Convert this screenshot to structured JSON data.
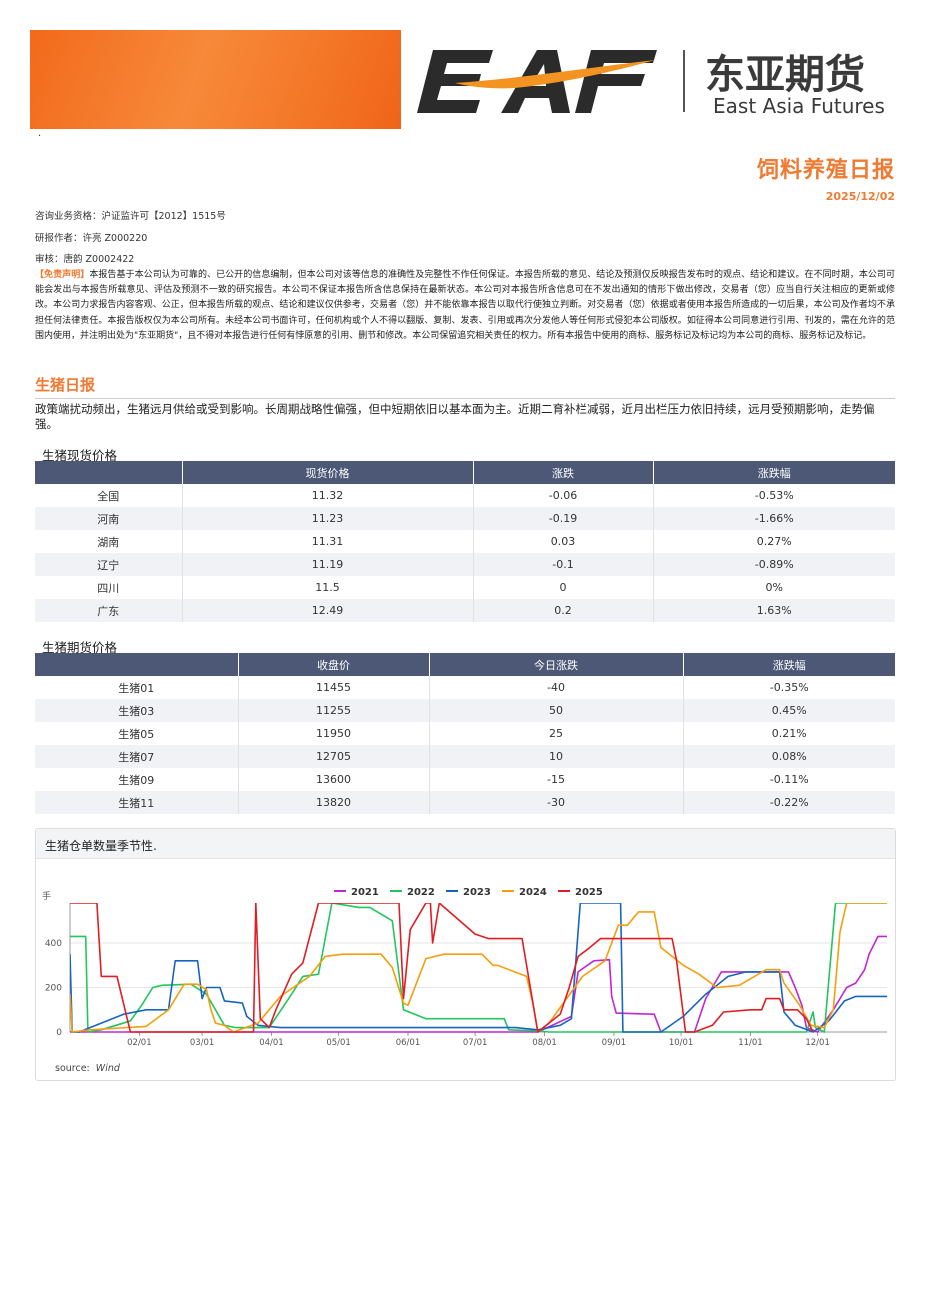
{
  "header": {
    "brand_letters": "EAF",
    "brand_cn": "东亚期货",
    "brand_en": "East Asia Futures",
    "dot": "·",
    "report_title": "饲料养殖日报",
    "report_date": "2025/12/02"
  },
  "meta": {
    "license": "咨询业务资格：沪证监许可【2012】1515号",
    "author": "研报作者：许亮 Z000220",
    "reviewer": "审核：唐韵 Z0002422"
  },
  "disclaimer": {
    "tag": "【免责声明】",
    "text": "本报告基于本公司认为可靠的、已公开的信息编制，但本公司对该等信息的准确性及完整性不作任何保证。本报告所载的意见、结论及预测仅反映报告发布时的观点、结论和建议。在不同时期，本公司可能会发出与本报告所载意见、评估及预测不一致的研究报告。本公司不保证本报告所含信息保持在最新状态。本公司对本报告所含信息可在不发出通知的情形下做出修改，交易者（您）应当自行关注相应的更新或修改。本公司力求报告内容客观、公正，但本报告所载的观点、结论和建议仅供参考，交易者（您）并不能依靠本报告以取代行使独立判断。对交易者（您）依据或者使用本报告所造成的一切后果，本公司及作者均不承担任何法律责任。本报告版权仅为本公司所有。未经本公司书面许可，任何机构或个人不得以翻版、复制、发表、引用或再次分发他人等任何形式侵犯本公司版权。如征得本公司同意进行引用、刊发的，需在允许的范围内使用，并注明出处为\"东亚期货\"，且不得对本报告进行任何有悖原意的引用、删节和修改。本公司保留追究相关责任的权力。所有本报告中使用的商标、服务标记及标记均为本公司的商标、服务标记及标记。"
  },
  "section": {
    "title": "生猪日报",
    "summary": "政策端扰动频出，生猪远月供给或受到影响。长周期战略性偏强，但中短期依旧以基本面为主。近期二育补栏减弱，近月出栏压力依旧持续，远月受预期影响，走势偏强。"
  },
  "spot_table": {
    "title": "生猪现货价格",
    "headers": [
      "",
      "现货价格",
      "涨跌",
      "涨跌幅"
    ],
    "rows": [
      [
        "全国",
        "11.32",
        "-0.06",
        "-0.53%"
      ],
      [
        "河南",
        "11.23",
        "-0.19",
        "-1.66%"
      ],
      [
        "湖南",
        "11.31",
        "0.03",
        "0.27%"
      ],
      [
        "辽宁",
        "11.19",
        "-0.1",
        "-0.89%"
      ],
      [
        "四川",
        "11.5",
        "0",
        "0%"
      ],
      [
        "广东",
        "12.49",
        "0.2",
        "1.63%"
      ]
    ]
  },
  "futures_table": {
    "title": "生猪期货价格",
    "headers": [
      "",
      "收盘价",
      "今日涨跌",
      "涨跌幅"
    ],
    "rows": [
      [
        "生猪01",
        "11455",
        "-40",
        "-0.35%"
      ],
      [
        "生猪03",
        "11255",
        "50",
        "0.45%"
      ],
      [
        "生猪05",
        "11950",
        "25",
        "0.21%"
      ],
      [
        "生猪07",
        "12705",
        "10",
        "0.08%"
      ],
      [
        "生猪09",
        "13600",
        "-15",
        "-0.11%"
      ],
      [
        "生猪11",
        "13820",
        "-30",
        "-0.22%"
      ]
    ]
  },
  "chart_block": {
    "title": "生猪仓单数量季节性.",
    "source_label": "source:",
    "source_value": "Wind"
  },
  "chart_data": {
    "type": "line",
    "ylabel": "手",
    "ylim": [
      0,
      580
    ],
    "yticks": [
      0,
      200,
      400
    ],
    "xlim": [
      1,
      366
    ],
    "xticks": [
      {
        "day": 32,
        "label": "02/01"
      },
      {
        "day": 60,
        "label": "03/01"
      },
      {
        "day": 91,
        "label": "04/01"
      },
      {
        "day": 121,
        "label": "05/01"
      },
      {
        "day": 152,
        "label": "06/01"
      },
      {
        "day": 182,
        "label": "07/01"
      },
      {
        "day": 213,
        "label": "08/01"
      },
      {
        "day": 244,
        "label": "09/01"
      },
      {
        "day": 274,
        "label": "10/01"
      },
      {
        "day": 305,
        "label": "11/01"
      },
      {
        "day": 335,
        "label": "12/01"
      }
    ],
    "legend_position": "top",
    "series": [
      {
        "name": "2021",
        "color": "#c026d3",
        "points": [
          [
            1,
            0
          ],
          [
            160,
            0
          ],
          [
            165,
            0
          ],
          [
            205,
            0
          ],
          [
            210,
            0
          ],
          [
            225,
            70
          ],
          [
            228,
            270
          ],
          [
            235,
            320
          ],
          [
            242,
            325
          ],
          [
            243,
            160
          ],
          [
            245,
            85
          ],
          [
            262,
            80
          ],
          [
            265,
            0
          ],
          [
            280,
            0
          ],
          [
            285,
            150
          ],
          [
            292,
            270
          ],
          [
            310,
            270
          ],
          [
            322,
            270
          ],
          [
            325,
            200
          ],
          [
            328,
            120
          ],
          [
            330,
            20
          ],
          [
            335,
            0
          ],
          [
            342,
            100
          ],
          [
            348,
            200
          ],
          [
            352,
            220
          ],
          [
            356,
            280
          ],
          [
            358,
            350
          ],
          [
            362,
            430
          ],
          [
            366,
            430
          ]
        ]
      },
      {
        "name": "2022",
        "color": "#22c55e",
        "points": [
          [
            1,
            430
          ],
          [
            8,
            430
          ],
          [
            9,
            0
          ],
          [
            15,
            10
          ],
          [
            28,
            50
          ],
          [
            33,
            120
          ],
          [
            38,
            200
          ],
          [
            42,
            210
          ],
          [
            55,
            215
          ],
          [
            62,
            170
          ],
          [
            70,
            30
          ],
          [
            75,
            20
          ],
          [
            90,
            20
          ],
          [
            100,
            170
          ],
          [
            105,
            250
          ],
          [
            112,
            260
          ],
          [
            118,
            580
          ],
          [
            130,
            560
          ],
          [
            135,
            560
          ],
          [
            145,
            500
          ],
          [
            150,
            100
          ],
          [
            160,
            60
          ],
          [
            175,
            60
          ],
          [
            195,
            60
          ],
          [
            197,
            10
          ],
          [
            210,
            5
          ],
          [
            215,
            0
          ],
          [
            230,
            0
          ],
          [
            265,
            0
          ],
          [
            280,
            0
          ],
          [
            300,
            0
          ],
          [
            330,
            0
          ],
          [
            333,
            90
          ],
          [
            334,
            20
          ],
          [
            338,
            0
          ],
          [
            343,
            580
          ],
          [
            366,
            580
          ]
        ]
      },
      {
        "name": "2023",
        "color": "#1565c0",
        "points": [
          [
            1,
            350
          ],
          [
            2,
            0
          ],
          [
            5,
            0
          ],
          [
            25,
            80
          ],
          [
            35,
            100
          ],
          [
            45,
            100
          ],
          [
            48,
            320
          ],
          [
            58,
            320
          ],
          [
            60,
            150
          ],
          [
            62,
            200
          ],
          [
            68,
            200
          ],
          [
            70,
            140
          ],
          [
            78,
            130
          ],
          [
            80,
            70
          ],
          [
            85,
            30
          ],
          [
            95,
            20
          ],
          [
            130,
            20
          ],
          [
            150,
            20
          ],
          [
            165,
            20
          ],
          [
            200,
            20
          ],
          [
            210,
            10
          ],
          [
            220,
            30
          ],
          [
            225,
            60
          ],
          [
            229,
            580
          ],
          [
            247,
            580
          ],
          [
            248,
            0
          ],
          [
            265,
            0
          ],
          [
            275,
            70
          ],
          [
            285,
            170
          ],
          [
            295,
            250
          ],
          [
            303,
            270
          ],
          [
            310,
            270
          ],
          [
            318,
            270
          ],
          [
            320,
            90
          ],
          [
            325,
            30
          ],
          [
            333,
            0
          ],
          [
            340,
            50
          ],
          [
            347,
            140
          ],
          [
            352,
            160
          ],
          [
            366,
            160
          ]
        ]
      },
      {
        "name": "2024",
        "color": "#f59e0b",
        "points": [
          [
            1,
            170
          ],
          [
            2,
            0
          ],
          [
            10,
            10
          ],
          [
            35,
            25
          ],
          [
            45,
            100
          ],
          [
            52,
            215
          ],
          [
            58,
            215
          ],
          [
            62,
            190
          ],
          [
            64,
            100
          ],
          [
            66,
            40
          ],
          [
            70,
            30
          ],
          [
            74,
            0
          ],
          [
            85,
            40
          ],
          [
            95,
            160
          ],
          [
            108,
            250
          ],
          [
            115,
            340
          ],
          [
            123,
            350
          ],
          [
            140,
            350
          ],
          [
            145,
            290
          ],
          [
            150,
            130
          ],
          [
            152,
            120
          ],
          [
            160,
            330
          ],
          [
            168,
            350
          ],
          [
            180,
            350
          ],
          [
            185,
            350
          ],
          [
            190,
            300
          ],
          [
            192,
            300
          ],
          [
            205,
            250
          ],
          [
            208,
            120
          ],
          [
            210,
            0
          ],
          [
            215,
            40
          ],
          [
            220,
            110
          ],
          [
            230,
            250
          ],
          [
            240,
            320
          ],
          [
            246,
            480
          ],
          [
            250,
            480
          ],
          [
            255,
            540
          ],
          [
            262,
            540
          ],
          [
            265,
            380
          ],
          [
            275,
            300
          ],
          [
            282,
            260
          ],
          [
            290,
            200
          ],
          [
            300,
            210
          ],
          [
            312,
            280
          ],
          [
            318,
            280
          ],
          [
            320,
            220
          ],
          [
            327,
            120
          ],
          [
            332,
            30
          ],
          [
            338,
            20
          ],
          [
            342,
            100
          ],
          [
            345,
            450
          ],
          [
            348,
            580
          ],
          [
            366,
            580
          ]
        ]
      },
      {
        "name": "2025",
        "color": "#e11d24",
        "points": [
          [
            1,
            580
          ],
          [
            13,
            580
          ],
          [
            15,
            250
          ],
          [
            22,
            250
          ],
          [
            28,
            0
          ],
          [
            50,
            0
          ],
          [
            83,
            0
          ],
          [
            84,
            580
          ],
          [
            86,
            60
          ],
          [
            90,
            20
          ],
          [
            93,
            100
          ],
          [
            100,
            260
          ],
          [
            105,
            310
          ],
          [
            112,
            580
          ],
          [
            140,
            580
          ],
          [
            148,
            580
          ],
          [
            150,
            150
          ],
          [
            153,
            460
          ],
          [
            160,
            580
          ],
          [
            162,
            580
          ],
          [
            163,
            400
          ],
          [
            166,
            580
          ],
          [
            182,
            440
          ],
          [
            188,
            420
          ],
          [
            198,
            420
          ],
          [
            203,
            420
          ],
          [
            208,
            120
          ],
          [
            210,
            0
          ],
          [
            220,
            80
          ],
          [
            224,
            200
          ],
          [
            228,
            340
          ],
          [
            232,
            370
          ],
          [
            238,
            420
          ],
          [
            248,
            420
          ],
          [
            262,
            420
          ],
          [
            270,
            420
          ],
          [
            272,
            320
          ],
          [
            276,
            0
          ],
          [
            280,
            0
          ],
          [
            288,
            30
          ],
          [
            293,
            90
          ],
          [
            305,
            100
          ],
          [
            310,
            100
          ],
          [
            312,
            150
          ],
          [
            318,
            150
          ],
          [
            320,
            100
          ],
          [
            326,
            100
          ],
          [
            330,
            60
          ],
          [
            333,
            0
          ]
        ]
      }
    ]
  },
  "colors": {
    "accent": "#f07a32",
    "table_header": "#4c5875",
    "table_stripe": "#f1f2f5"
  }
}
